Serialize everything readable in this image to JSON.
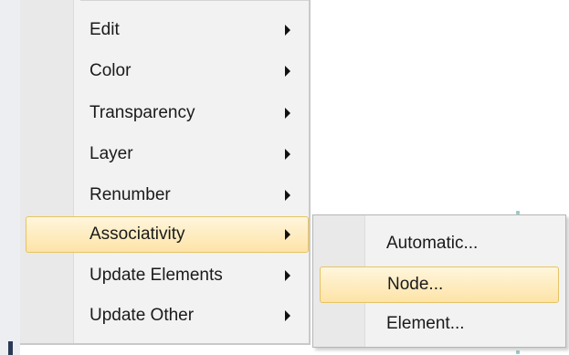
{
  "menu": {
    "items": [
      {
        "label": "Edit",
        "has_submenu": true,
        "highlighted": false
      },
      {
        "label": "Color",
        "has_submenu": true,
        "highlighted": false
      },
      {
        "label": "Transparency",
        "has_submenu": true,
        "highlighted": false
      },
      {
        "label": "Layer",
        "has_submenu": true,
        "highlighted": false
      },
      {
        "label": "Renumber",
        "has_submenu": true,
        "highlighted": false
      },
      {
        "label": "Associativity",
        "has_submenu": true,
        "highlighted": true
      },
      {
        "label": "Update Elements",
        "has_submenu": true,
        "highlighted": false
      },
      {
        "label": "Update Other",
        "has_submenu": true,
        "highlighted": false
      }
    ]
  },
  "submenu": {
    "parent": "Associativity",
    "items": [
      {
        "label": "Automatic...",
        "highlighted": false
      },
      {
        "label": "Node...",
        "highlighted": true
      },
      {
        "label": "Element...",
        "highlighted": false
      }
    ]
  },
  "colors": {
    "menu_background": "#f2f2f2",
    "gutter": "#e9e9e9",
    "highlight_top": "#fff6dc",
    "highlight_bottom": "#fde3a7",
    "highlight_border": "#e5c365",
    "text": "#1a1a1a"
  },
  "icons": {
    "submenu_arrow": "triangle-right-icon"
  }
}
